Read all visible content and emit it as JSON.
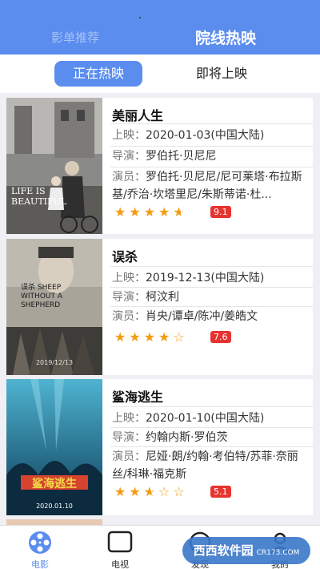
{
  "header": {
    "tabs": [
      {
        "label": "影单推荐"
      },
      {
        "label": "院线热映"
      }
    ]
  },
  "segment": {
    "now_showing": "正在热映",
    "coming_soon": "即将上映"
  },
  "labels": {
    "release": "上映：",
    "director": "导演：",
    "cast": "演员："
  },
  "movies": [
    {
      "title": "美丽人生",
      "release": "2020-01-03(中国大陆)",
      "director": "罗伯托·贝尼尼",
      "cast": "罗伯托·贝尼尼/尼可莱塔·布拉斯基/乔治·坎塔里尼/朱斯蒂诺·杜...",
      "rating": 4.5,
      "score": "9.1",
      "poster_text": "LIFE IS BEAUTIFUL"
    },
    {
      "title": "误杀",
      "release": "2019-12-13(中国大陆)",
      "director": "柯汶利",
      "cast": "肖央/谭卓/陈冲/姜皓文",
      "rating": 4,
      "score": "7.6",
      "poster_text": "误杀 SHEEP WITHOUT A SHEPHERD",
      "poster_date": "2019/12/13"
    },
    {
      "title": "鲨海逃生",
      "release": "2020-01-10(中国大陆)",
      "director": "约翰内斯·罗伯茨",
      "cast": "尼娅·朗/约翰·考伯特/苏菲·奈丽丝/科琳·福克斯",
      "rating": 2.5,
      "score": "5.1",
      "poster_text": "鲨海逃生",
      "poster_date": "2020.01.10"
    }
  ],
  "tabbar": [
    {
      "label": "电影",
      "icon": "film-reel-icon"
    },
    {
      "label": "电视",
      "icon": "tv-icon"
    },
    {
      "label": "发现",
      "icon": "discover-icon"
    },
    {
      "label": "我的",
      "icon": "user-icon"
    }
  ],
  "watermark": {
    "text": "西西软件园",
    "sub": "CR173.COM"
  },
  "colors": {
    "accent": "#5b8def",
    "star": "#f39c12",
    "score_bg": "#e8332f"
  }
}
